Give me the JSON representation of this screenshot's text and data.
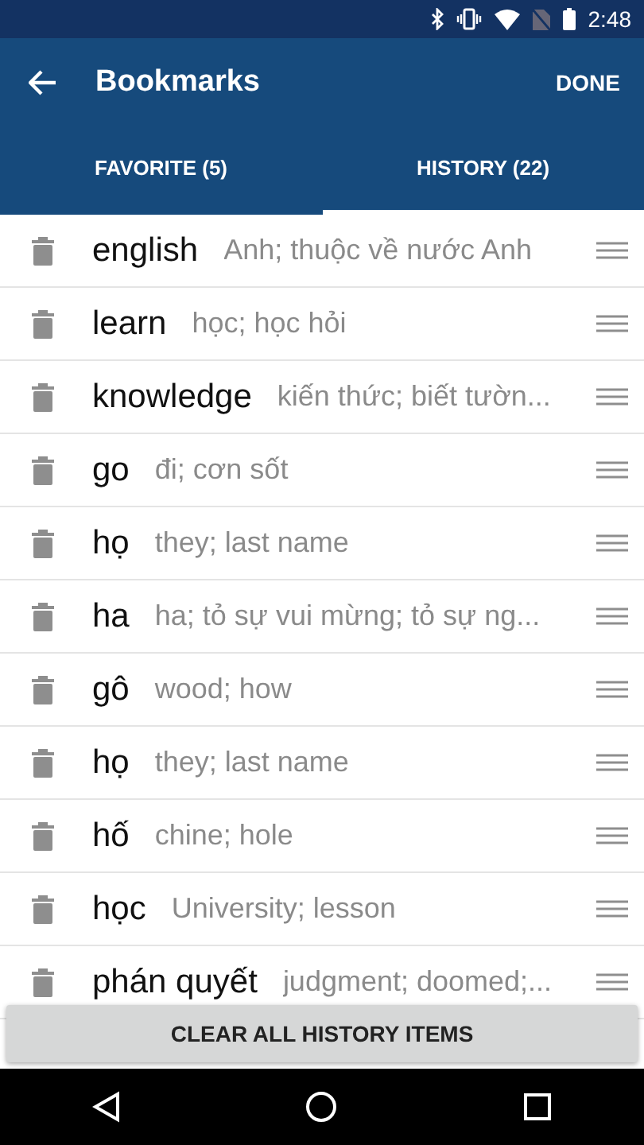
{
  "status_bar": {
    "time": "2:48"
  },
  "app_bar": {
    "title": "Bookmarks",
    "action": "DONE"
  },
  "tabs": [
    {
      "label": "FAVORITE (5)",
      "selected": false
    },
    {
      "label": "HISTORY (22)",
      "selected": true
    }
  ],
  "items": [
    {
      "word": "english",
      "meaning": "Anh; thuộc về nước Anh"
    },
    {
      "word": "learn",
      "meaning": "học; học hỏi"
    },
    {
      "word": "knowledge",
      "meaning": "kiến thức; biết tườn..."
    },
    {
      "word": "go",
      "meaning": "đi; cơn sốt"
    },
    {
      "word": "họ",
      "meaning": "they; last name"
    },
    {
      "word": "ha",
      "meaning": "ha; tỏ sự vui mừng; tỏ sự ng..."
    },
    {
      "word": "gô",
      "meaning": "wood; how"
    },
    {
      "word": "họ",
      "meaning": "they; last name"
    },
    {
      "word": "hố",
      "meaning": "chine; hole"
    },
    {
      "word": "học",
      "meaning": "University; lesson"
    },
    {
      "word": "phán quyết",
      "meaning": "judgment; doomed;..."
    }
  ],
  "clear_button": "CLEAR ALL HISTORY ITEMS"
}
